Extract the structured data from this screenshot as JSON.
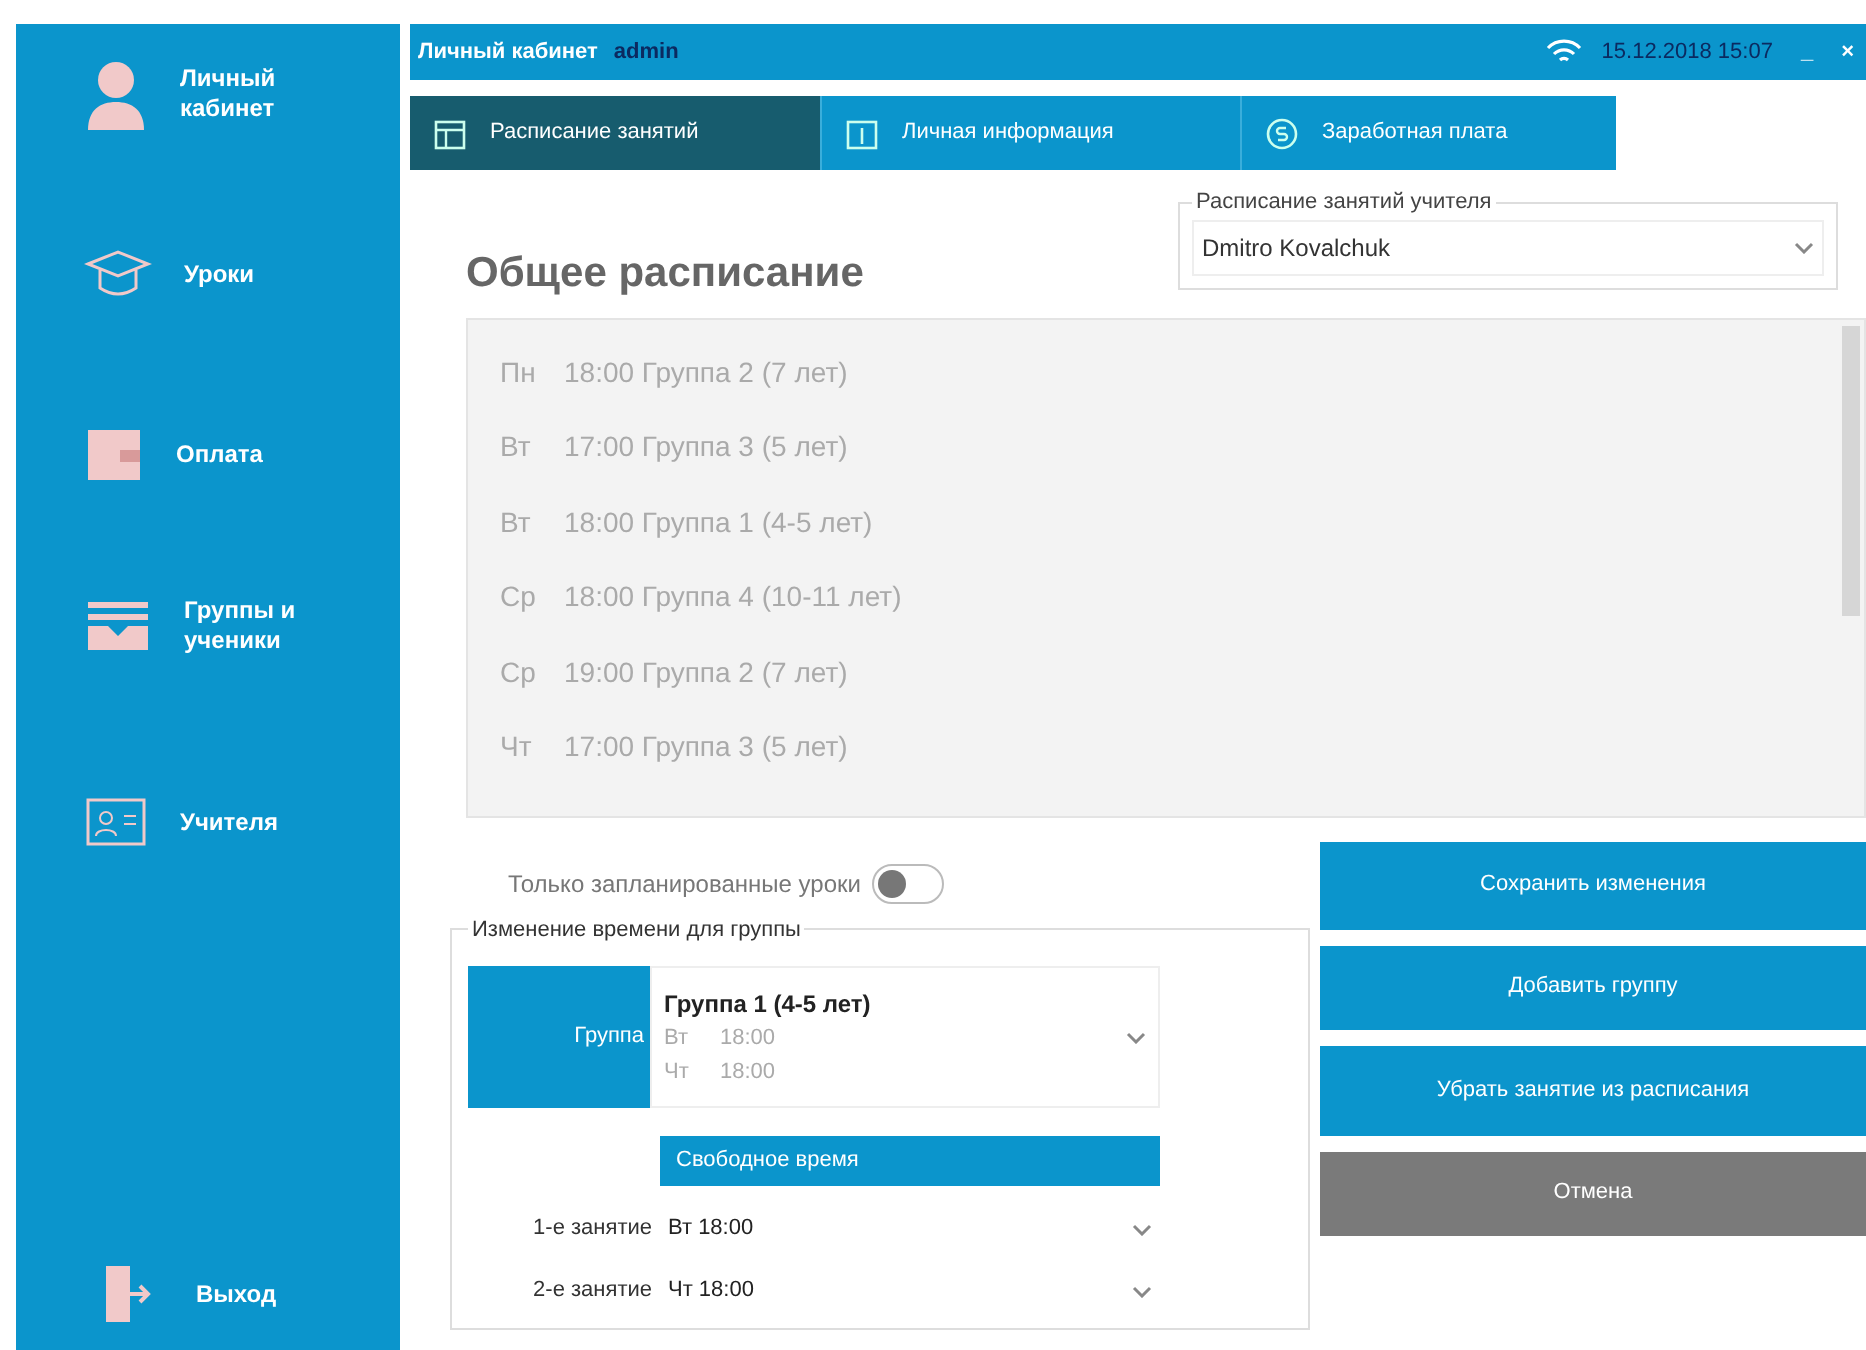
{
  "header": {
    "title": "Личный кабинет",
    "user": "admin",
    "datetime": "15.12.2018 15:07",
    "minimize": "_",
    "close": "×"
  },
  "sidebar": {
    "items": [
      {
        "kind": "profile",
        "label": "Личный кабинет"
      },
      {
        "kind": "lessons",
        "label": "Уроки"
      },
      {
        "kind": "payment",
        "label": "Оплата"
      },
      {
        "kind": "groups",
        "label": "Группы и ученики"
      },
      {
        "kind": "teachers",
        "label": "Учителя"
      }
    ],
    "logout": {
      "label": "Выход"
    }
  },
  "tabs": [
    {
      "kind": "calendar",
      "label": "Расписание занятий",
      "selected": true
    },
    {
      "kind": "info",
      "label": "Личная информация",
      "selected": false
    },
    {
      "kind": "money",
      "label": "Заработная плата",
      "selected": false
    }
  ],
  "title": "Общее расписание",
  "teacher_select": {
    "legend": "Расписание занятий учителя",
    "value": "Dmitro Kovalchuk"
  },
  "schedule": [
    {
      "day": "Пн",
      "text": "18:00 Группа 2 (7 лет)"
    },
    {
      "day": "Вт",
      "text": "17:00 Группа 3 (5 лет)"
    },
    {
      "day": "Вт",
      "text": "18:00 Группа 1 (4-5 лет)"
    },
    {
      "day": "Ср",
      "text": "18:00 Группа 4 (10-11 лет)"
    },
    {
      "day": "Ср",
      "text": "19:00 Группа 2 (7 лет)"
    },
    {
      "day": "Чт",
      "text": "17:00 Группа 3 (5 лет)"
    }
  ],
  "only_planned": {
    "label": "Только запланированные уроки",
    "on": false
  },
  "group_edit": {
    "legend": "Изменение времени для группы",
    "group_label": "Группа",
    "group": {
      "name": "Группа 1 (4-5 лет)",
      "times": [
        {
          "day": "Вт",
          "time": "18:00"
        },
        {
          "day": "Чт",
          "time": "18:00"
        }
      ]
    },
    "free_time": "Свободное время",
    "lessons": [
      {
        "label": "1-е занятие",
        "value": "Вт 18:00"
      },
      {
        "label": "2-е занятие",
        "value": "Чт 18:00"
      }
    ]
  },
  "buttons": [
    {
      "kind": "primary",
      "label": "Сохранить изменения"
    },
    {
      "kind": "primary",
      "label": "Добавить группу"
    },
    {
      "kind": "primary",
      "label": "Убрать занятие из расписания"
    },
    {
      "kind": "cancel",
      "label": "Отмена"
    }
  ]
}
